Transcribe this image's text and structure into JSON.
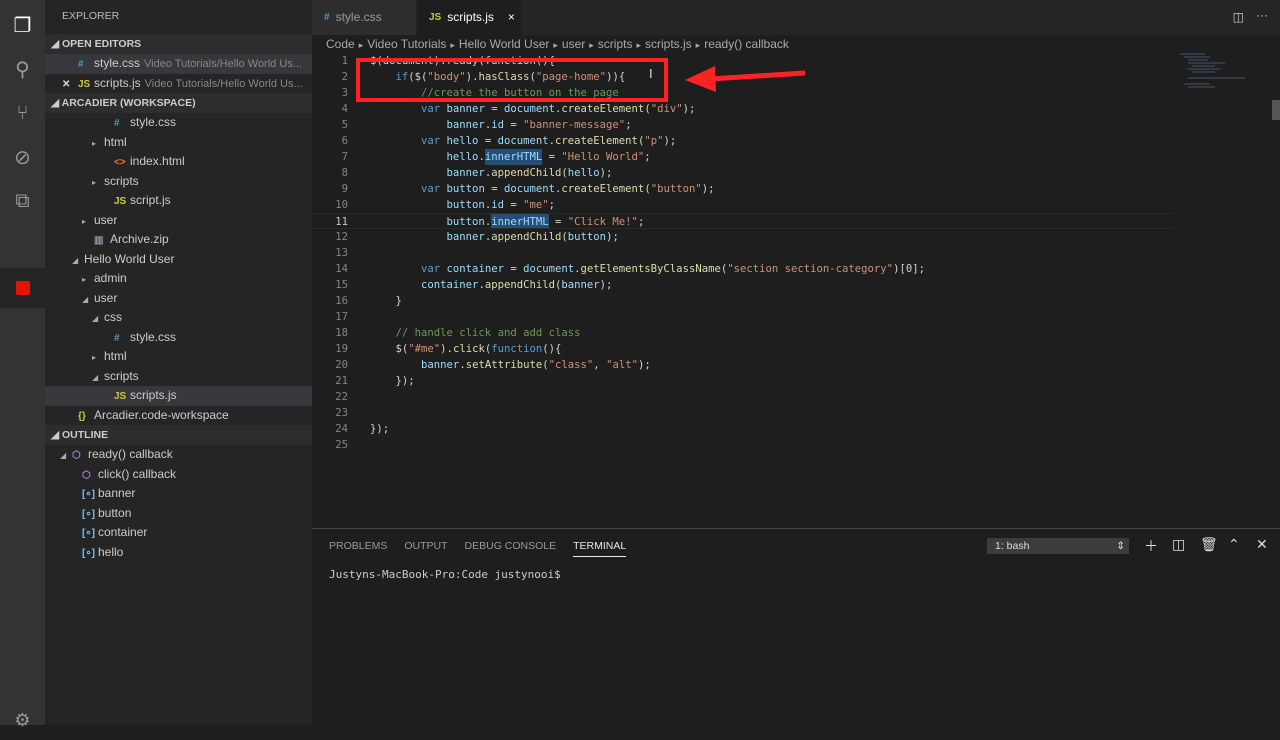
{
  "activity_bar": {
    "items": [
      "files-icon",
      "search-icon",
      "source-control-icon",
      "debug-icon",
      "extensions-icon",
      "stop-icon"
    ],
    "settings": "gear-icon"
  },
  "sidebar": {
    "title": "EXPLORER",
    "open_editors": {
      "header": "OPEN EDITORS",
      "items": [
        {
          "name": "style.css",
          "path": "Video Tutorials/Hello World Us...",
          "icon": "#",
          "color": "#519aba",
          "close": false
        },
        {
          "name": "scripts.js",
          "path": "Video Tutorials/Hello World Us...",
          "icon": "JS",
          "color": "#cbcb41",
          "close": true
        }
      ]
    },
    "workspace": {
      "header": "ARCADIER (WORKSPACE)",
      "items": [
        {
          "label": "style.css",
          "indent": 3,
          "icon": "#",
          "color": "#519aba",
          "twisty": ""
        },
        {
          "label": "html",
          "indent": 2,
          "icon": "",
          "twisty": "▸"
        },
        {
          "label": "index.html",
          "indent": 3,
          "icon": "<>",
          "color": "#e37933",
          "twisty": ""
        },
        {
          "label": "scripts",
          "indent": 2,
          "icon": "",
          "twisty": "▸"
        },
        {
          "label": "script.js",
          "indent": 3,
          "icon": "JS",
          "color": "#cbcb41",
          "twisty": ""
        },
        {
          "label": "user",
          "indent": 1,
          "icon": "",
          "twisty": "▸"
        },
        {
          "label": "Archive.zip",
          "indent": 1,
          "icon": "▥",
          "color": "#8a9ba8",
          "twisty": ""
        },
        {
          "label": "Hello World User",
          "indent": 0,
          "icon": "",
          "twisty": "◢"
        },
        {
          "label": "admin",
          "indent": 1,
          "icon": "",
          "twisty": "▸"
        },
        {
          "label": "user",
          "indent": 1,
          "icon": "",
          "twisty": "◢"
        },
        {
          "label": "css",
          "indent": 2,
          "icon": "",
          "twisty": "◢"
        },
        {
          "label": "style.css",
          "indent": 3,
          "icon": "#",
          "color": "#519aba",
          "twisty": ""
        },
        {
          "label": "html",
          "indent": 2,
          "icon": "",
          "twisty": "▸"
        },
        {
          "label": "scripts",
          "indent": 2,
          "icon": "",
          "twisty": "◢"
        },
        {
          "label": "scripts.js",
          "indent": 3,
          "icon": "JS",
          "color": "#cbcb41",
          "twisty": "",
          "selected": true
        },
        {
          "label": "Arcadier.code-workspace",
          "indent": -1,
          "icon": "{}",
          "color": "#cbcb41",
          "twisty": ""
        }
      ]
    },
    "outline": {
      "header": "OUTLINE",
      "items": [
        {
          "label": "ready() callback",
          "indent": 0,
          "icon": "⬡",
          "color": "#b180d7",
          "twisty": "◢"
        },
        {
          "label": "click() callback",
          "indent": 1,
          "icon": "⬡",
          "color": "#b180d7",
          "twisty": ""
        },
        {
          "label": "banner",
          "indent": 1,
          "icon": "[∘]",
          "color": "#75beff",
          "twisty": ""
        },
        {
          "label": "button",
          "indent": 1,
          "icon": "[∘]",
          "color": "#75beff",
          "twisty": ""
        },
        {
          "label": "container",
          "indent": 1,
          "icon": "[∘]",
          "color": "#75beff",
          "twisty": ""
        },
        {
          "label": "hello",
          "indent": 1,
          "icon": "[∘]",
          "color": "#75beff",
          "twisty": ""
        }
      ]
    }
  },
  "tabs": [
    {
      "label": "style.css",
      "icon": "#",
      "color": "#519aba",
      "active": false
    },
    {
      "label": "scripts.js",
      "icon": "JS",
      "color": "#cbcb41",
      "active": true,
      "close": "×"
    }
  ],
  "breadcrumb": [
    "Code",
    "Video Tutorials",
    "Hello World User",
    "user",
    "scripts",
    "scripts.js",
    "ready() callback"
  ],
  "code": [
    [
      [
        "$(document).ready(function(){",
        "p"
      ]
    ],
    [
      [
        "    "
      ],
      [
        "if",
        "k"
      ],
      [
        "($(",
        "p"
      ],
      [
        "\"body\"",
        "s"
      ],
      [
        ").",
        "p"
      ],
      [
        "hasClass",
        "f"
      ],
      [
        "(",
        "p"
      ],
      [
        "\"page-home\"",
        "s"
      ],
      [
        ")){",
        "p"
      ]
    ],
    [
      [
        "        "
      ],
      [
        "//create the button on the page",
        "c"
      ]
    ],
    [
      [
        "        "
      ],
      [
        "var",
        "k"
      ],
      [
        " banner",
        "v"
      ],
      [
        " = ",
        "p"
      ],
      [
        "document",
        "v"
      ],
      [
        ".",
        "p"
      ],
      [
        "createElement",
        "f"
      ],
      [
        "(",
        "p"
      ],
      [
        "\"div\"",
        "s"
      ],
      [
        ");",
        "p"
      ]
    ],
    [
      [
        "            "
      ],
      [
        "banner",
        "v"
      ],
      [
        ".",
        "p"
      ],
      [
        "id",
        "v"
      ],
      [
        " = ",
        "p"
      ],
      [
        "\"banner-message\"",
        "s"
      ],
      [
        ";",
        "p"
      ]
    ],
    [
      [
        "        "
      ],
      [
        "var",
        "k"
      ],
      [
        " hello",
        "v"
      ],
      [
        " = ",
        "p"
      ],
      [
        "document",
        "v"
      ],
      [
        ".",
        "p"
      ],
      [
        "createElement",
        "f"
      ],
      [
        "(",
        "p"
      ],
      [
        "\"p\"",
        "s"
      ],
      [
        ");",
        "p"
      ]
    ],
    [
      [
        "            "
      ],
      [
        "hello",
        "v"
      ],
      [
        ".",
        "p"
      ],
      [
        "innerHTML",
        "v h"
      ],
      [
        " = ",
        "p"
      ],
      [
        "\"Hello World\"",
        "s"
      ],
      [
        ";",
        "p"
      ]
    ],
    [
      [
        "            "
      ],
      [
        "banner",
        "v"
      ],
      [
        ".",
        "p"
      ],
      [
        "appendChild",
        "f"
      ],
      [
        "(",
        "p"
      ],
      [
        "hello",
        "v"
      ],
      [
        ");",
        "p"
      ]
    ],
    [
      [
        "        "
      ],
      [
        "var",
        "k"
      ],
      [
        " button",
        "v"
      ],
      [
        " = ",
        "p"
      ],
      [
        "document",
        "v"
      ],
      [
        ".",
        "p"
      ],
      [
        "createElement",
        "f"
      ],
      [
        "(",
        "p"
      ],
      [
        "\"button\"",
        "s"
      ],
      [
        ");",
        "p"
      ]
    ],
    [
      [
        "            "
      ],
      [
        "button",
        "v"
      ],
      [
        ".",
        "p"
      ],
      [
        "id",
        "v"
      ],
      [
        " = ",
        "p"
      ],
      [
        "\"me\"",
        "s"
      ],
      [
        ";",
        "p"
      ]
    ],
    [
      [
        "            "
      ],
      [
        "button",
        "v"
      ],
      [
        ".",
        "p"
      ],
      [
        "innerHTML",
        "v h"
      ],
      [
        " = ",
        "p"
      ],
      [
        "\"Click Me!\"",
        "s"
      ],
      [
        ";",
        "p"
      ]
    ],
    [
      [
        "            "
      ],
      [
        "banner",
        "v"
      ],
      [
        ".",
        "p"
      ],
      [
        "appendChild",
        "f"
      ],
      [
        "(",
        "p"
      ],
      [
        "button",
        "v"
      ],
      [
        ");",
        "p"
      ]
    ],
    [
      [
        ""
      ]
    ],
    [
      [
        "        "
      ],
      [
        "var",
        "k"
      ],
      [
        " container",
        "v"
      ],
      [
        " = ",
        "p"
      ],
      [
        "document",
        "v"
      ],
      [
        ".",
        "p"
      ],
      [
        "getElementsByClassName",
        "f"
      ],
      [
        "(",
        "p"
      ],
      [
        "\"section section-category\"",
        "s"
      ],
      [
        ")[0];",
        "p"
      ]
    ],
    [
      [
        "        "
      ],
      [
        "container",
        "v"
      ],
      [
        ".",
        "p"
      ],
      [
        "appendChild",
        "f"
      ],
      [
        "(",
        "p"
      ],
      [
        "banner",
        "v"
      ],
      [
        ");",
        "p"
      ]
    ],
    [
      [
        "    "
      ],
      [
        "}",
        "p"
      ]
    ],
    [
      [
        ""
      ]
    ],
    [
      [
        "    "
      ],
      [
        "// handle click and add class",
        "c"
      ]
    ],
    [
      [
        "    "
      ],
      [
        "$(",
        "p"
      ],
      [
        "\"#me\"",
        "s"
      ],
      [
        ").",
        "p"
      ],
      [
        "click",
        "f"
      ],
      [
        "(",
        "p"
      ],
      [
        "function",
        "k"
      ],
      [
        "(){",
        "p"
      ]
    ],
    [
      [
        "        "
      ],
      [
        "banner",
        "v"
      ],
      [
        ".",
        "p"
      ],
      [
        "setAttribute",
        "f"
      ],
      [
        "(",
        "p"
      ],
      [
        "\"class\"",
        "s"
      ],
      [
        ", ",
        "p"
      ],
      [
        "\"alt\"",
        "s"
      ],
      [
        ");",
        "p"
      ]
    ],
    [
      [
        "    "
      ],
      [
        "});",
        "p"
      ]
    ],
    [
      [
        ""
      ]
    ],
    [
      [
        ""
      ]
    ],
    [
      [
        "});",
        "p"
      ]
    ],
    [
      [
        ""
      ]
    ]
  ],
  "current_line": 11,
  "annotation_color": "#ff2222",
  "panel": {
    "tabs": [
      "PROBLEMS",
      "OUTPUT",
      "DEBUG CONSOLE",
      "TERMINAL"
    ],
    "active": "TERMINAL",
    "terminal_select": "1: bash",
    "prompt": "Justyns-MacBook-Pro:Code justynooi$"
  }
}
